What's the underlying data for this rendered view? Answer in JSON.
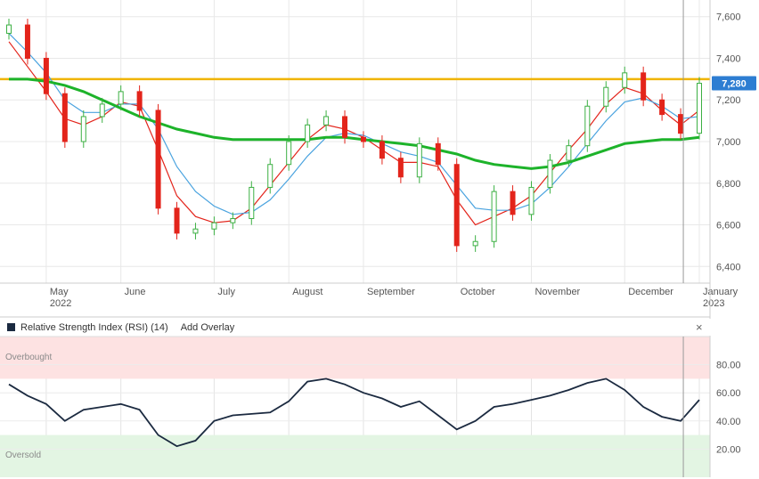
{
  "price_panel": {
    "last_price_label": "7,280",
    "y_ticks": [
      "7,600",
      "7,400",
      "7,200",
      "7,000",
      "6,800",
      "6,600",
      "6,400"
    ],
    "x_ticks": [
      {
        "label": "May",
        "sub": "2022"
      },
      {
        "label": "June",
        "sub": ""
      },
      {
        "label": "July",
        "sub": ""
      },
      {
        "label": "August",
        "sub": ""
      },
      {
        "label": "September",
        "sub": ""
      },
      {
        "label": "October",
        "sub": ""
      },
      {
        "label": "November",
        "sub": ""
      },
      {
        "label": "December",
        "sub": ""
      },
      {
        "label": "January",
        "sub": "2023"
      }
    ],
    "colors": {
      "up": "#3cb043",
      "down": "#e3241b",
      "ma_short": "#e3241b",
      "ma_mid": "#4aa3df",
      "ma_long": "#1db32a",
      "level": "#f0b400",
      "label_bg": "#2d7dd2"
    }
  },
  "rsi_panel": {
    "title": "Relative Strength Index (RSI) (14)",
    "add_overlay": "Add Overlay",
    "close_symbol": "×",
    "overbought_label": "Overbought",
    "oversold_label": "Oversold",
    "y_ticks": [
      "80.00",
      "60.00",
      "40.00",
      "20.00"
    ],
    "colors": {
      "line": "#1b2a40",
      "overbought_bg": "#fde2e2",
      "oversold_bg": "#e3f5e3"
    }
  },
  "chart_data": [
    {
      "type": "candlestick",
      "title": "",
      "ylim": [
        6320,
        7680
      ],
      "level_line": 7300,
      "last_value": 7280,
      "x": [
        "2022-04-19",
        "2022-04-25",
        "2022-05-02",
        "2022-05-09",
        "2022-05-16",
        "2022-05-23",
        "2022-05-30",
        "2022-06-06",
        "2022-06-13",
        "2022-06-20",
        "2022-06-27",
        "2022-07-04",
        "2022-07-11",
        "2022-07-18",
        "2022-07-25",
        "2022-08-01",
        "2022-08-08",
        "2022-08-15",
        "2022-08-22",
        "2022-08-29",
        "2022-09-05",
        "2022-09-12",
        "2022-09-19",
        "2022-09-26",
        "2022-10-03",
        "2022-10-10",
        "2022-10-17",
        "2022-10-24",
        "2022-10-31",
        "2022-11-07",
        "2022-11-14",
        "2022-11-21",
        "2022-11-28",
        "2022-12-05",
        "2022-12-12",
        "2022-12-19",
        "2022-12-26",
        "2023-01-02"
      ],
      "close": [
        7560,
        7400,
        7230,
        7000,
        7120,
        7180,
        7240,
        7150,
        6680,
        6560,
        6580,
        6610,
        6630,
        6780,
        6890,
        7000,
        7080,
        7120,
        7020,
        7000,
        6920,
        6830,
        6990,
        6890,
        6500,
        6520,
        6760,
        6650,
        6780,
        6910,
        6980,
        7170,
        7260,
        7330,
        7200,
        7130,
        7040,
        7280
      ],
      "series": [
        {
          "name": "",
          "values": [
            7480,
            7360,
            7240,
            7110,
            7080,
            7120,
            7190,
            7170,
            6960,
            6740,
            6640,
            6610,
            6620,
            6680,
            6790,
            6900,
            7010,
            7080,
            7060,
            7020,
            6960,
            6900,
            6900,
            6880,
            6720,
            6600,
            6640,
            6680,
            6740,
            6850,
            6960,
            7060,
            7180,
            7260,
            7230,
            7150,
            7080,
            7150
          ]
        },
        {
          "name": "",
          "values": [
            7520,
            7430,
            7330,
            7200,
            7140,
            7140,
            7180,
            7180,
            7060,
            6880,
            6760,
            6690,
            6650,
            6660,
            6720,
            6820,
            6930,
            7020,
            7040,
            7030,
            6990,
            6950,
            6930,
            6900,
            6790,
            6680,
            6670,
            6670,
            6700,
            6780,
            6880,
            6990,
            7100,
            7190,
            7210,
            7170,
            7110,
            7120
          ]
        },
        {
          "name": "",
          "values": [
            7300,
            7300,
            7290,
            7270,
            7240,
            7200,
            7160,
            7120,
            7090,
            7060,
            7040,
            7020,
            7010,
            7010,
            7010,
            7010,
            7010,
            7020,
            7020,
            7010,
            7000,
            6990,
            6980,
            6960,
            6940,
            6910,
            6890,
            6880,
            6870,
            6880,
            6900,
            6930,
            6960,
            6990,
            7000,
            7010,
            7010,
            7020
          ]
        }
      ]
    },
    {
      "type": "line",
      "title": "",
      "ylim": [
        0,
        100
      ],
      "overbought": 70,
      "oversold": 30,
      "series": [
        {
          "name": "",
          "values": [
            66,
            58,
            52,
            40,
            48,
            50,
            52,
            48,
            30,
            22,
            26,
            40,
            44,
            45,
            46,
            54,
            68,
            70,
            66,
            60,
            56,
            50,
            54,
            44,
            34,
            40,
            50,
            52,
            55,
            58,
            62,
            67,
            70,
            62,
            50,
            43,
            40,
            55
          ]
        }
      ]
    }
  ]
}
